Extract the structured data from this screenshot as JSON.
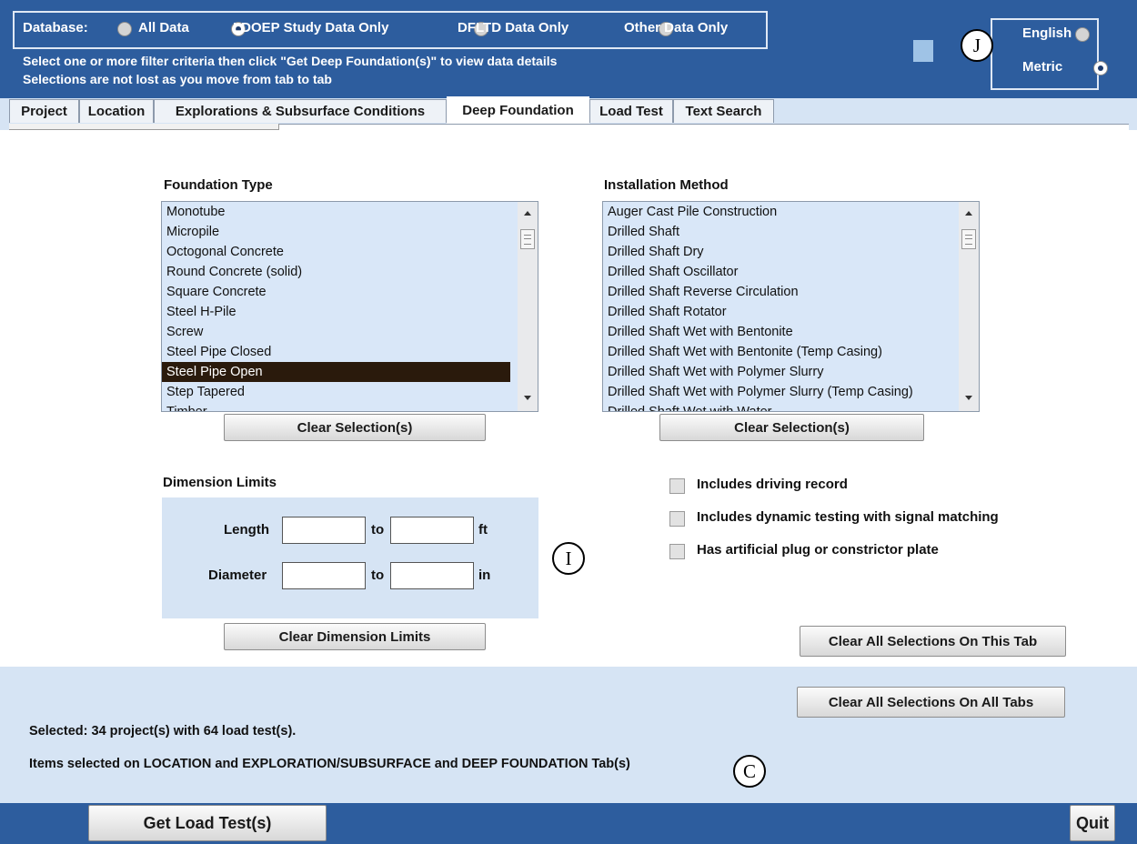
{
  "header": {
    "database_label": "Database:",
    "db_options": [
      "All Data",
      "LDOEP Study Data  Only",
      "DFLTD Data Only",
      "Other Data Only"
    ],
    "instructions": [
      "Select one or more filter criteria then click \"Get Deep Foundation(s)\" to view data details",
      "Selections are not lost as you move from tab to tab"
    ],
    "units": [
      "English",
      "Metric"
    ],
    "selected_unit": "Metric"
  },
  "tabs": [
    "Project",
    "Location",
    "Explorations & Subsurface Conditions",
    "Deep Foundation",
    "Load Test",
    "Text Search"
  ],
  "active_tab": "Deep Foundation",
  "foundation_type": {
    "label": "Foundation Type",
    "items": [
      "Monotube",
      "Micropile",
      "Octogonal Concrete",
      "Round Concrete  (solid)",
      "Square Concrete",
      "Steel H-Pile",
      "Screw",
      "Steel Pipe Closed",
      "Steel Pipe Open",
      "Step Tapered",
      "Timber"
    ],
    "selected": "Steel Pipe Open",
    "clear_label": "Clear Selection(s)"
  },
  "installation_method": {
    "label": "Installation Method",
    "items": [
      "Auger Cast Pile Construction",
      "Drilled Shaft",
      "Drilled Shaft Dry",
      "Drilled Shaft Oscillator",
      "Drilled Shaft Reverse Circulation",
      "Drilled Shaft Rotator",
      "Drilled Shaft Wet with Bentonite",
      "Drilled Shaft Wet with Bentonite (Temp Casing)",
      "Drilled Shaft Wet with Polymer Slurry",
      "Drilled Shaft Wet with Polymer Slurry (Temp Casing)",
      "Drilled Shaft Wet with Water"
    ],
    "clear_label": "Clear Selection(s)"
  },
  "dimension_limits": {
    "label": "Dimension Limits",
    "length_label": "Length",
    "diameter_label": "Diameter",
    "to_label": "to",
    "length_unit": "ft",
    "diameter_unit": "in",
    "length_from": "",
    "length_to": "",
    "diameter_from": "",
    "diameter_to": "",
    "clear_label": "Clear Dimension Limits"
  },
  "checkboxes": [
    "Includes driving record",
    "Includes dynamic testing with signal matching",
    "Has artificial plug or constrictor plate"
  ],
  "clear_tab_label": "Clear All Selections On This Tab",
  "clear_all_label": "Clear All Selections On All Tabs",
  "status": {
    "selected": "Selected: 34 project(s) with 64 load test(s).",
    "items_selected": "Items selected on LOCATION and EXPLORATION/SUBSURFACE and DEEP FOUNDATION Tab(s)"
  },
  "get_button": "Get Load Test(s)",
  "quit_button": "Quit",
  "callouts": {
    "j": "J",
    "i": "I",
    "c": "C"
  },
  "colors": {
    "header": "#2d5d9e",
    "panel_bg": "#d6e4f4",
    "list_bg": "#d9e7f8",
    "selected_row": "#2a1a0c"
  }
}
